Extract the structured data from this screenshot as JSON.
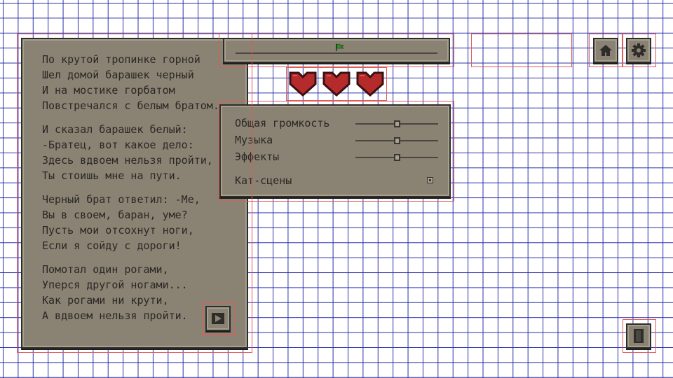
{
  "poem": {
    "stanzas": [
      [
        "По крутой тропинке горной",
        "Шел домой барашек черный",
        "И на мостике горбатом",
        "Повстречался с белым братом."
      ],
      [
        "И сказал барашек белый:",
        "-Братец, вот какое дело:",
        "Здесь вдвоем нельзя пройти,",
        "Ты стоишь мне на пути."
      ],
      [
        "Черный брат ответил: -Ме,",
        "Вы в своем, баран, уме?",
        "Пусть мои отсохнут ноги,",
        "Если я сойду с дороги!"
      ],
      [
        "Помотал один рогами,",
        "Уперся другой ногами...",
        "Как рогами ни крути,",
        "А вдвоем нельзя пройти."
      ]
    ]
  },
  "progress": {
    "value": 0.5,
    "flag_icon": "flag-icon",
    "flag_color": "#3a8a2e"
  },
  "hearts": {
    "count": 3,
    "color": "#b52a2a"
  },
  "settings": {
    "master_label": "Общая громкость",
    "music_label": "Музыка",
    "effects_label": "Эффекты",
    "cutscenes_label": "Кат-сцены",
    "master_value": 0.5,
    "music_value": 0.5,
    "effects_value": 0.5,
    "cutscenes_enabled": true
  },
  "buttons": {
    "home_icon": "home-icon",
    "settings_icon": "gear-icon",
    "book_icon": "book-icon",
    "play_icon": "play-icon"
  },
  "colors": {
    "panel": "#8a8272",
    "grid_line": "#2b2fa8",
    "debug_outline": "#e05a5a"
  }
}
